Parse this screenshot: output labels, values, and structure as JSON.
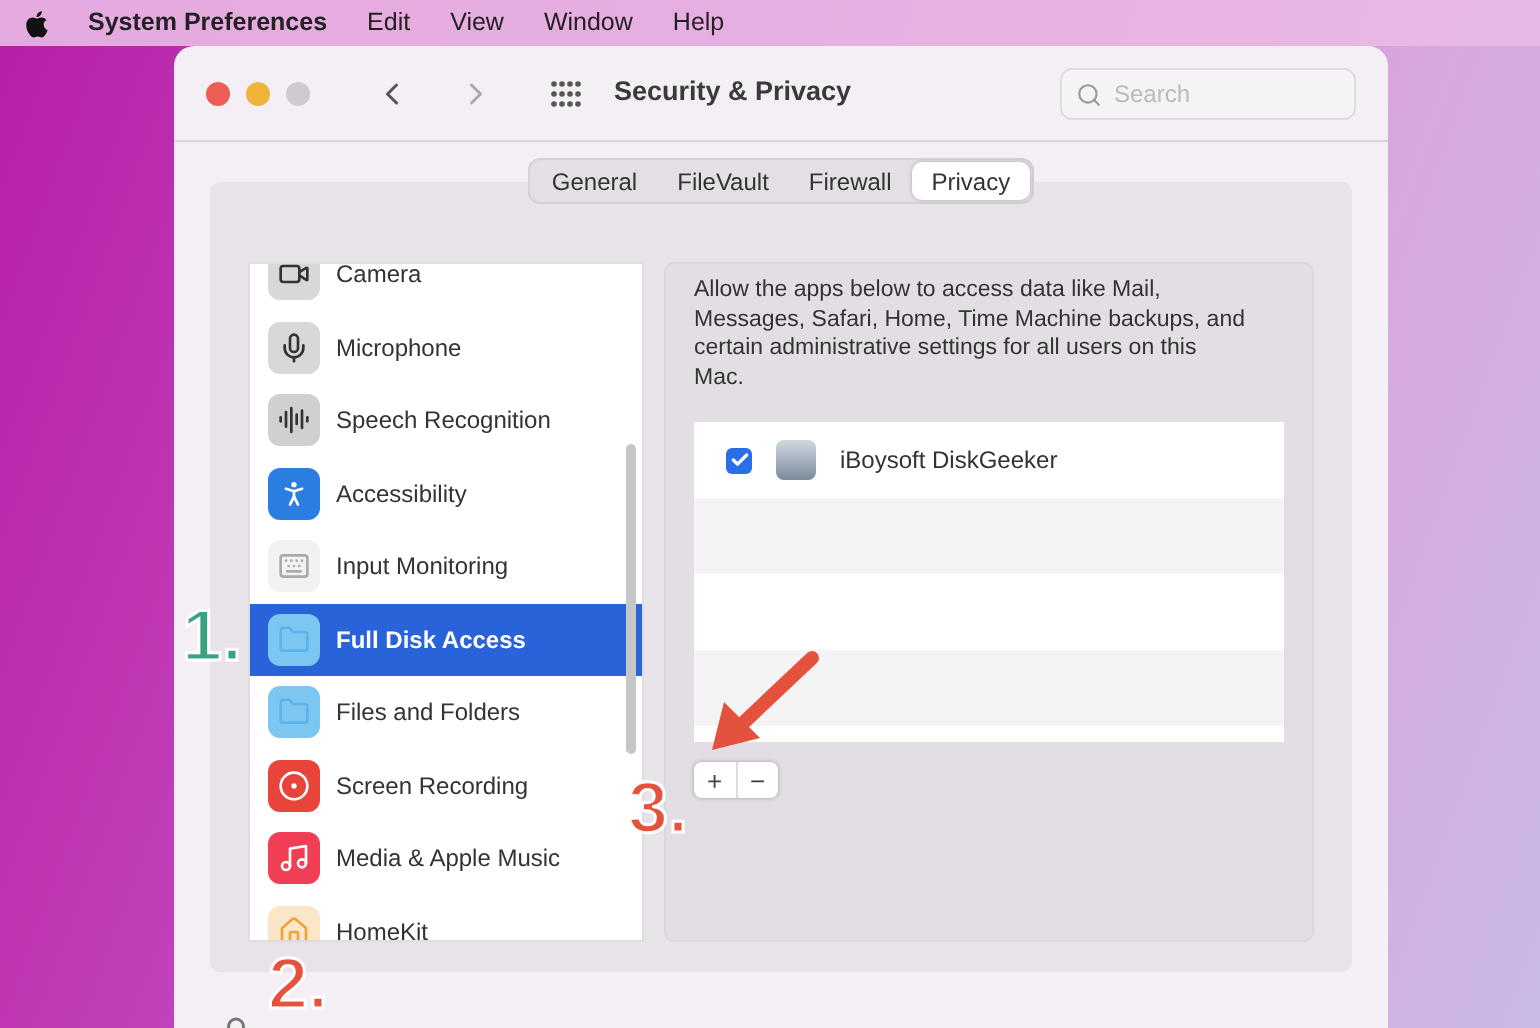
{
  "menu_bar": {
    "app_name": "System Preferences",
    "items": [
      "Edit",
      "View",
      "Window",
      "Help"
    ]
  },
  "window": {
    "title": "Security & Privacy",
    "search": {
      "placeholder": "Search"
    }
  },
  "tabs": [
    {
      "label": "General",
      "selected": false
    },
    {
      "label": "FileVault",
      "selected": false
    },
    {
      "label": "Firewall",
      "selected": false
    },
    {
      "label": "Privacy",
      "selected": true
    }
  ],
  "sidebar": {
    "items": [
      {
        "label": "Camera",
        "selected": false
      },
      {
        "label": "Microphone",
        "selected": false
      },
      {
        "label": "Speech Recognition",
        "selected": false
      },
      {
        "label": "Accessibility",
        "selected": false
      },
      {
        "label": "Input Monitoring",
        "selected": false
      },
      {
        "label": "Full Disk Access",
        "selected": true
      },
      {
        "label": "Files and Folders",
        "selected": false
      },
      {
        "label": "Screen Recording",
        "selected": false
      },
      {
        "label": "Media & Apple Music",
        "selected": false
      },
      {
        "label": "HomeKit",
        "selected": false
      }
    ]
  },
  "detail": {
    "description": "Allow the apps below to access data like Mail, Messages, Safari, Home, Time Machine backups, and certain administrative settings for all users on this Mac.",
    "apps": [
      {
        "name": "iBoysoft DiskGeeker",
        "checked": true
      }
    ],
    "buttons": [
      "+",
      "−"
    ]
  },
  "annotations": [
    {
      "label": "1."
    },
    {
      "label": "2."
    },
    {
      "label": "3."
    }
  ]
}
